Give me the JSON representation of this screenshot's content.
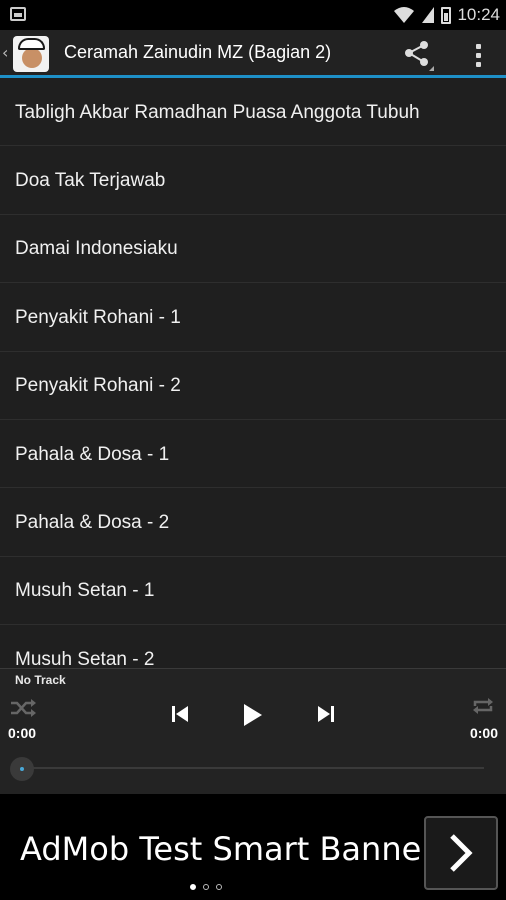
{
  "status_bar": {
    "time": "10:24"
  },
  "action_bar": {
    "back_glyph": "‹",
    "title": "Ceramah Zainudin MZ (Bagian 2)",
    "accent_color": "#1e90c8",
    "icons": [
      "app-logo",
      "share-icon",
      "overflow-menu-icon"
    ]
  },
  "list": {
    "items": [
      {
        "label": "Tabligh Akbar Ramadhan Puasa Anggota Tubuh"
      },
      {
        "label": "Doa Tak Terjawab"
      },
      {
        "label": "Damai Indonesiaku"
      },
      {
        "label": "Penyakit Rohani - 1"
      },
      {
        "label": "Penyakit Rohani - 2"
      },
      {
        "label": "Pahala & Dosa - 1"
      },
      {
        "label": "Pahala & Dosa - 2"
      },
      {
        "label": "Musuh Setan - 1"
      },
      {
        "label": "Musuh Setan - 2"
      }
    ]
  },
  "player": {
    "track_label": "No Track",
    "elapsed": "0:00",
    "duration": "0:00",
    "progress": 0,
    "icons": [
      "shuffle-icon",
      "previous-icon",
      "play-icon",
      "next-icon",
      "repeat-icon"
    ]
  },
  "ad": {
    "text": "AdMob Test Smart Banner",
    "pager_dots": 3,
    "active_dot": 0
  }
}
